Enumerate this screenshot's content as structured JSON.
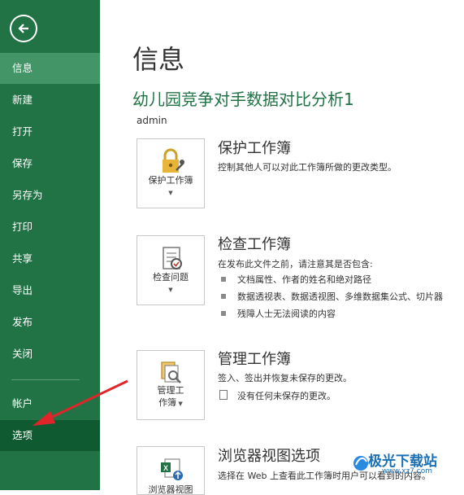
{
  "sidebar": {
    "items": [
      {
        "label": "信息"
      },
      {
        "label": "新建"
      },
      {
        "label": "打开"
      },
      {
        "label": "保存"
      },
      {
        "label": "另存为"
      },
      {
        "label": "打印"
      },
      {
        "label": "共享"
      },
      {
        "label": "导出"
      },
      {
        "label": "发布"
      },
      {
        "label": "关闭"
      },
      {
        "label": "帐户"
      },
      {
        "label": "选项"
      }
    ]
  },
  "main": {
    "title": "信息",
    "doc_name": "幼儿园竞争对手数据对比分析1",
    "author": "admin",
    "protect": {
      "button_label": "保护工作簿",
      "title": "保护工作簿",
      "desc": "控制其他人可以对此工作簿所做的更改类型。"
    },
    "inspect": {
      "button_label": "检查问题",
      "title": "检查工作簿",
      "desc": "在发布此文件之前，请注意其是否包含:",
      "bullets": [
        "文档属性、作者的姓名和绝对路径",
        "数据透视表、数据透视图、多维数据集公式、切片器",
        "残障人士无法阅读的内容"
      ]
    },
    "manage": {
      "button_label_1": "管理工",
      "button_label_2": "作簿",
      "title": "管理工作簿",
      "desc": "签入、签出并恢复未保存的更改。",
      "no_changes": "没有任何未保存的更改。"
    },
    "browser": {
      "button_label": "浏览器视图",
      "title": "浏览器视图选项",
      "desc": "选择在 Web 上查看此工作簿时用户可以看到的内容。"
    }
  },
  "watermark": {
    "text": "极光下载站",
    "url": "www.xz7.com"
  },
  "annotation_color": "#e0252a"
}
